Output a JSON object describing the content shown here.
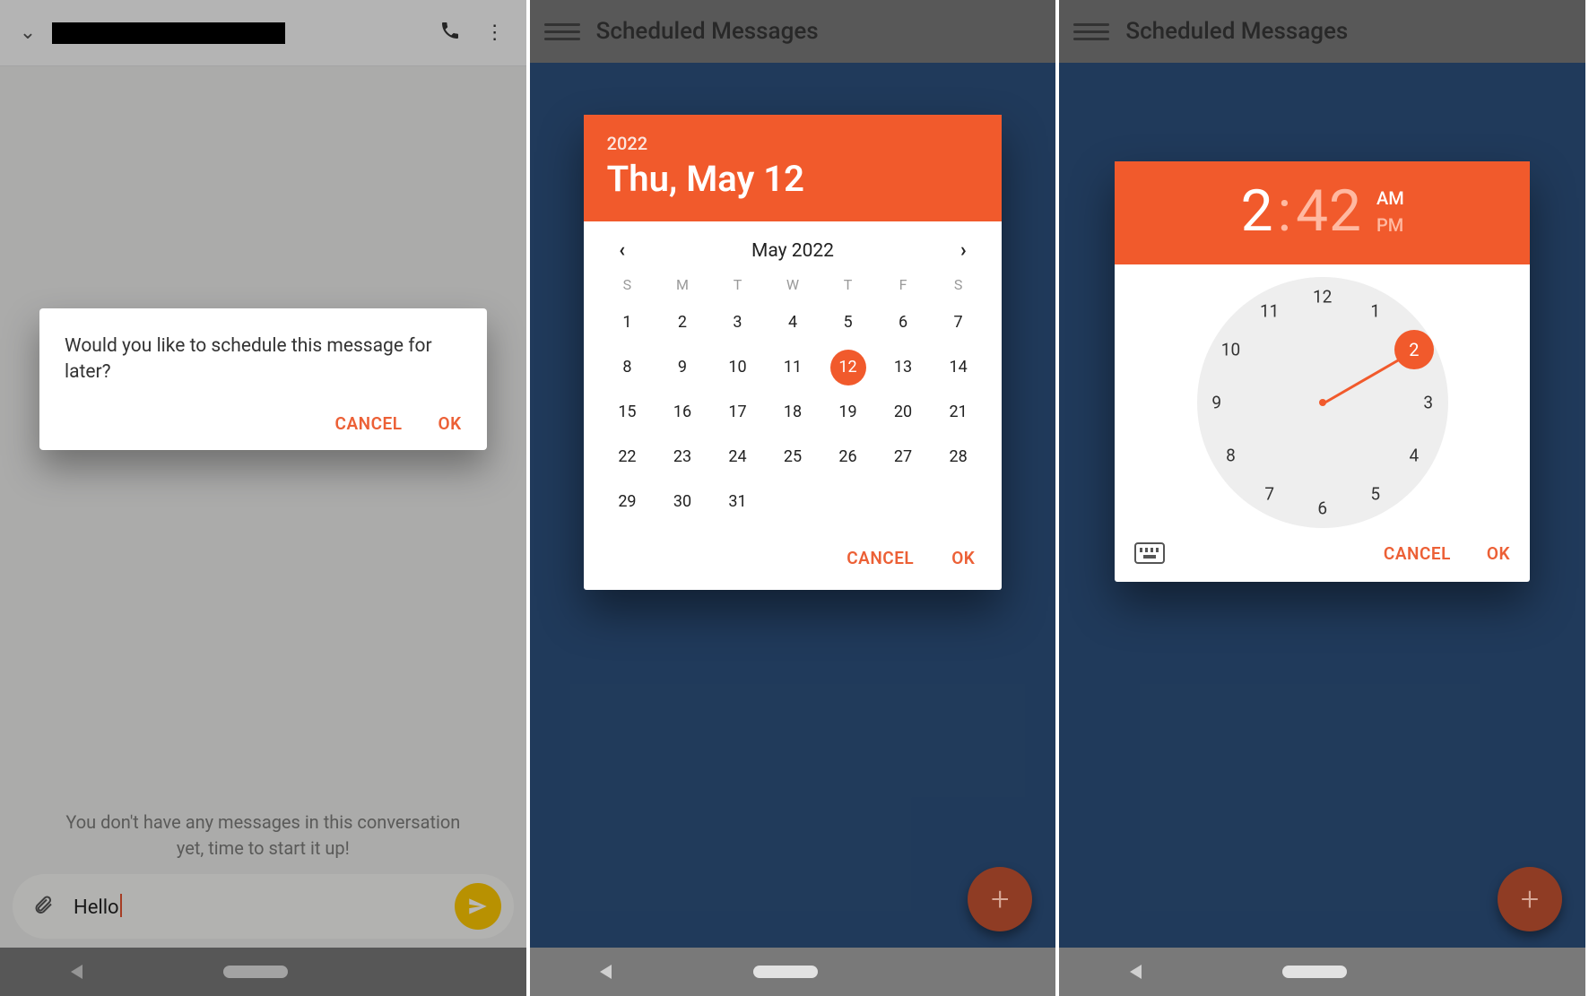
{
  "colors": {
    "accent": "#f15a2c",
    "accent_text": "#ec6036",
    "bg_blue": "#20487a"
  },
  "screen1": {
    "empty_text": "You don't have any messages in this conversation yet, time to start it up!",
    "compose_value": "Hello",
    "dialog": {
      "message": "Would you like to schedule this message for later?",
      "cancel": "CANCEL",
      "ok": "OK"
    }
  },
  "screen2": {
    "appbar_title": "Scheduled Messages",
    "fab_glyph": "+",
    "picker": {
      "year": "2022",
      "date_line": "Thu, May 12",
      "month_label": "May 2022",
      "dow": [
        "S",
        "M",
        "T",
        "W",
        "T",
        "F",
        "S"
      ],
      "days": [
        "1",
        "2",
        "3",
        "4",
        "5",
        "6",
        "7",
        "8",
        "9",
        "10",
        "11",
        "12",
        "13",
        "14",
        "15",
        "16",
        "17",
        "18",
        "19",
        "20",
        "21",
        "22",
        "23",
        "24",
        "25",
        "26",
        "27",
        "28",
        "29",
        "30",
        "31"
      ],
      "selected_day": "12",
      "cancel": "CANCEL",
      "ok": "OK"
    }
  },
  "screen3": {
    "appbar_title": "Scheduled Messages",
    "fab_glyph": "+",
    "picker": {
      "hour": "2",
      "minute": "42",
      "am": "AM",
      "pm": "PM",
      "clock_numbers": [
        "12",
        "1",
        "2",
        "3",
        "4",
        "5",
        "6",
        "7",
        "8",
        "9",
        "10",
        "11"
      ],
      "selected_hour": "2",
      "cancel": "CANCEL",
      "ok": "OK"
    }
  }
}
